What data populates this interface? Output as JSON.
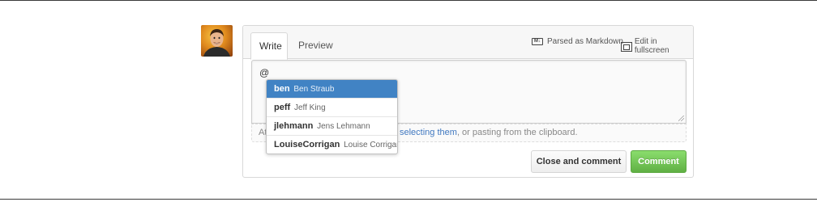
{
  "comment_form": {
    "tabs": [
      {
        "label": "Write",
        "active": true
      },
      {
        "label": "Preview",
        "active": false
      }
    ],
    "toolbar": {
      "markdown_icon_text": "M↓",
      "markdown_label": "Parsed as Markdown",
      "fullscreen_label": "Edit in fullscreen"
    },
    "textarea_value": "@",
    "drag_hint": {
      "start": "At",
      "link": "selecting them",
      "end": ", or pasting from the clipboard."
    },
    "buttons": {
      "close_and_comment": "Close and comment",
      "comment": "Comment"
    }
  },
  "suggestions": [
    {
      "login": "ben",
      "name": "Ben Straub",
      "active": true
    },
    {
      "login": "peff",
      "name": "Jeff King",
      "active": false
    },
    {
      "login": "jlehmann",
      "name": "Jens Lehmann",
      "active": false
    },
    {
      "login": "LouiseCorrigan",
      "name": "Louise Corrigan",
      "active": false
    }
  ],
  "colors": {
    "accent_blue": "#4183c4",
    "comment_green": "#60b044",
    "link_blue": "#4078c0"
  }
}
